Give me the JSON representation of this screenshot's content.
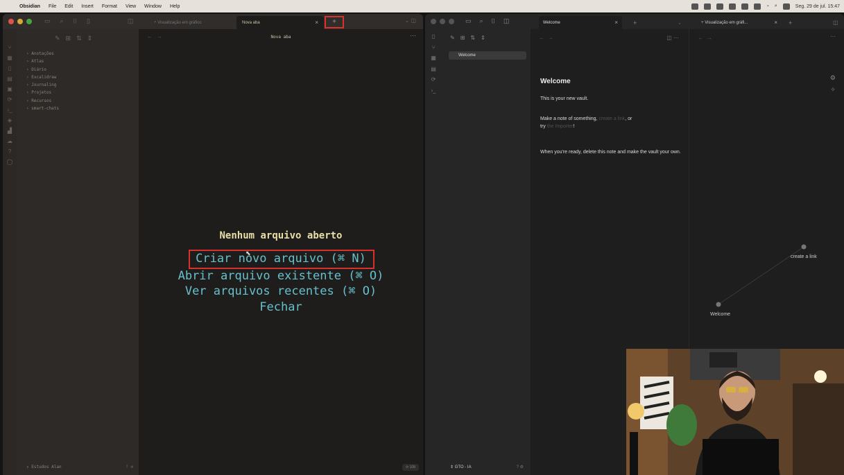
{
  "menubar": {
    "apple": "",
    "app_name": "Obsidian",
    "items": [
      "File",
      "Edit",
      "Insert",
      "Format",
      "View",
      "Window",
      "Help"
    ],
    "datetime": "Seg. 29 de jul. 15:47"
  },
  "left_window": {
    "tabs": {
      "graph": "Visualização em gráfico",
      "new_tab": "Nova aba",
      "close": "×",
      "new_tab_plus": "+"
    },
    "sidebar": {
      "folders": [
        "Anotações",
        "Atlas",
        "Diário",
        "Excalidraw",
        "Journaling",
        "Projetos",
        "Recursos",
        "smart-chats"
      ],
      "vault_name": "Estudos Alan"
    },
    "editor": {
      "header_title": "Nova aba",
      "empty_title": "Nenhum arquivo aberto",
      "actions": {
        "create": "Criar novo arquivo (⌘ N)",
        "open": "Abrir arquivo existente (⌘ O)",
        "recent": "Ver arquivos recentes (⌘ O)",
        "close": "Fechar"
      }
    },
    "status": "108"
  },
  "right_window": {
    "tabs": {
      "welcome": "Welcome",
      "graph": "Visualização em gráfi...",
      "close": "×",
      "plus": "+"
    },
    "file_tree": {
      "items": [
        "Welcome"
      ],
      "vault_name": "GTO - IA"
    },
    "note": {
      "title": "Welcome",
      "p1": "This is your new vault.",
      "p2_before": "Make a note of something, ",
      "p2_link": "create a link",
      "p2_after": ", or",
      "p2_line2_before": "try ",
      "p2_link2": "the Importer",
      "p2_line2_after": "!",
      "p3": "When you're ready, delete this note and make the vault your own."
    },
    "graph": {
      "nodes": [
        {
          "id": "create-a-link",
          "label": "create a link"
        },
        {
          "id": "welcome",
          "label": "Welcome"
        }
      ]
    }
  },
  "colors": {
    "highlight_red": "#d8322e",
    "action_cyan": "#66c0cc",
    "empty_title_yellow": "#e8dfa8"
  }
}
